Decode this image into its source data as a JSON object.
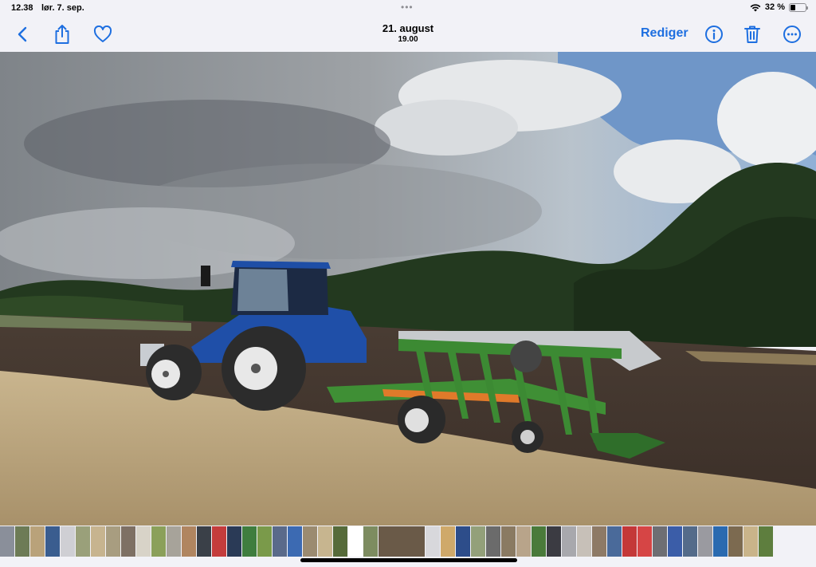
{
  "status_bar": {
    "time": "12.38",
    "date": "lør. 7. sep.",
    "multitask_dots": "•••",
    "battery_percent": "32 %",
    "battery_level": 0.32,
    "icons": [
      "wifi-icon",
      "battery-icon"
    ]
  },
  "nav": {
    "title": "21. august",
    "subtitle": "19.00",
    "edit_label": "Rediger",
    "icons": [
      "back-icon",
      "share-icon",
      "favorite-heart-icon",
      "info-icon",
      "trash-icon",
      "more-icon"
    ],
    "accent_color": "#1e6fe0"
  },
  "photo": {
    "content": "blue-tractor-with-green-reversible-plough-icon"
  },
  "thumbnails": {
    "colors": [
      "#8a8f9a",
      "#6d7b56",
      "#b9a27a",
      "#3a5d8f",
      "#cfcfd4",
      "#9aa07a",
      "#c7b48f",
      "#a89d80",
      "#7e7064",
      "#d8d3c8",
      "#8ba05a",
      "#a7a39a",
      "#b08560",
      "#3a4048",
      "#c43c3c",
      "#2a3a56",
      "#3f7d3e",
      "#7a9a4a",
      "#5a6a8a",
      "#3c6ab2",
      "#9b8b70",
      "#c7b58f",
      "#566b3a",
      "#ffffff",
      "#7d8c60",
      "#6a5a48",
      "#d8d8dc",
      "#cfa96a",
      "#2d4d8a",
      "#93a07a",
      "#6b6b6b",
      "#8a7a62",
      "#b8a48a",
      "#4a7a3a",
      "#3b3b42",
      "#a8a8ad",
      "#c7c0b8",
      "#8e7a66",
      "#4a6a9a",
      "#c43838",
      "#d64545",
      "#6e6e73",
      "#3b5da8",
      "#546b8a",
      "#9a9aa0",
      "#2a6ab0",
      "#7c6a50",
      "#c9b48a",
      "#5e7e3e"
    ],
    "selected_index": 25
  }
}
